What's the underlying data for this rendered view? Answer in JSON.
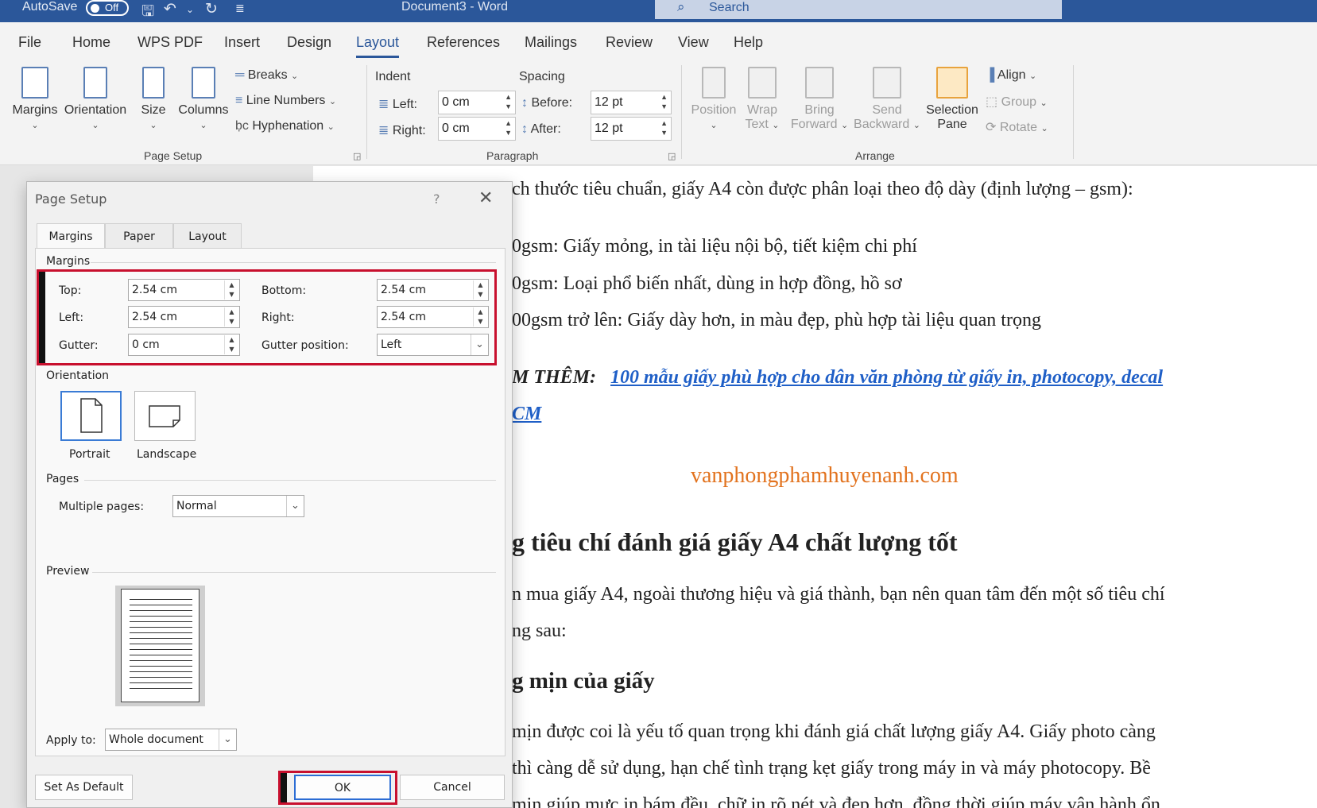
{
  "titlebar": {
    "autosave_label": "AutoSave",
    "autosave_state": "Off",
    "doc_title": "Document3  -  Word",
    "search_placeholder": "Search"
  },
  "tabs": [
    "File",
    "Home",
    "WPS PDF",
    "Insert",
    "Design",
    "Layout",
    "References",
    "Mailings",
    "Review",
    "View",
    "Help"
  ],
  "active_tab": "Layout",
  "ribbon": {
    "page_setup": {
      "label": "Page Setup",
      "margins": "Margins",
      "orientation": "Orientation",
      "size": "Size",
      "columns": "Columns",
      "breaks": "Breaks",
      "line_numbers": "Line Numbers",
      "hyphenation": "Hyphenation"
    },
    "paragraph": {
      "label": "Paragraph",
      "indent": "Indent",
      "spacing": "Spacing",
      "left_label": "Left:",
      "right_label": "Right:",
      "before_label": "Before:",
      "after_label": "After:",
      "left_value": "0 cm",
      "right_value": "0 cm",
      "before_value": "12 pt",
      "after_value": "12 pt"
    },
    "arrange": {
      "label": "Arrange",
      "position": "Position",
      "wrap_1": "Wrap",
      "wrap_2": "Text",
      "bring_1": "Bring",
      "bring_2": "Forward",
      "send_1": "Send",
      "send_2": "Backward",
      "selection_1": "Selection",
      "selection_2": "Pane",
      "align": "Align",
      "group": "Group",
      "rotate": "Rotate"
    }
  },
  "document": {
    "lines": [
      "ch thước tiêu chuẩn, giấy A4 còn được phân loại theo độ dày (định lượng – gsm):",
      "0gsm: Giấy mỏng, in tài liệu nội bộ, tiết kiệm chi phí",
      "0gsm: Loại phổ biến nhất, dùng in hợp đồng, hồ sơ",
      "00gsm trở lên: Giấy dày hơn, in màu đẹp, phù hợp tài liệu quan trọng"
    ],
    "see_more_prefix": "M THÊM:",
    "see_more_link": "100 mẫu giấy phù hợp cho dân văn phòng từ giấy in, photocopy, decal",
    "see_more_link_2": "CM",
    "watermark_site": "vanphongphamhuyenanh.com",
    "heading": "g tiêu chí đánh giá giấy A4 chất lượng tốt",
    "para_1": "n mua giấy A4, ngoài thương hiệu và giá thành, bạn nên quan tâm đến một số tiêu chí",
    "para_2": "ng sau:",
    "subheading": "g mịn của giấy",
    "para_3": "mịn được coi là yếu tố quan trọng khi đánh giá chất lượng giấy A4. Giấy photo càng",
    "para_4": "thì càng dễ sử dụng, hạn chế tình trạng kẹt giấy trong máy in và máy photocopy. Bề",
    "para_5": "mịn giúp mực in bám đều, chữ in rõ nét và đẹp hơn, đồng thời giúp máy vận hành ổn"
  },
  "dialog": {
    "title": "Page Setup",
    "help": "?",
    "tabs": [
      "Margins",
      "Paper",
      "Layout"
    ],
    "margins_section": "Margins",
    "top_label": "Top:",
    "top_value": "2.54 cm",
    "bottom_label": "Bottom:",
    "bottom_value": "2.54 cm",
    "left_label": "Left:",
    "left_value": "2.54 cm",
    "right_label": "Right:",
    "right_value": "2.54 cm",
    "gutter_label": "Gutter:",
    "gutter_value": "0 cm",
    "gutter_pos_label": "Gutter position:",
    "gutter_pos_value": "Left",
    "orientation_section": "Orientation",
    "portrait": "Portrait",
    "landscape": "Landscape",
    "pages_section": "Pages",
    "multiple_pages_label": "Multiple pages:",
    "multiple_pages_value": "Normal",
    "preview_section": "Preview",
    "apply_to_label": "Apply to:",
    "apply_to_value": "Whole document",
    "set_default": "Set As Default",
    "ok": "OK",
    "cancel": "Cancel"
  },
  "colors": {
    "title_bar": "#2b579a",
    "highlight_box": "#c8102e",
    "link": "#1f5fc7",
    "watermark": "#e2731f"
  }
}
